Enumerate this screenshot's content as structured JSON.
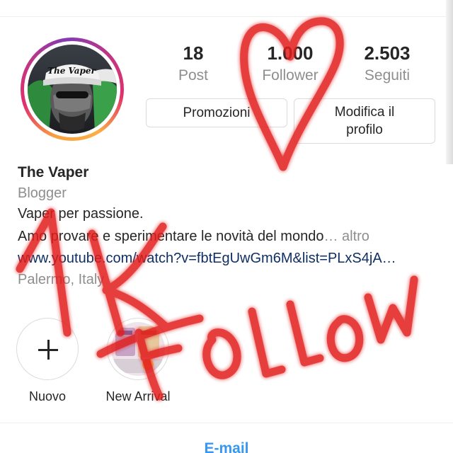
{
  "profile": {
    "avatar_text": "The Vaper",
    "name": "The Vaper",
    "category": "Blogger",
    "bio_line1": "Vaper per passione.",
    "bio_line2": "Amo provare e sperimentare le novità del mondo",
    "bio_ellipsis": "… ",
    "bio_more": "altro",
    "link": "www.youtube.com/watch?v=fbtEgUwGm6M&list=PLxS4jA…",
    "location": "Palermo, Italy"
  },
  "stats": [
    {
      "value": "18",
      "label": "Post"
    },
    {
      "value": "1.000",
      "label": "Follower"
    },
    {
      "value": "2.503",
      "label": "Seguiti"
    }
  ],
  "buttons": {
    "promo": "Promozioni",
    "edit_line1": "Modifica il",
    "edit_line2": "profilo"
  },
  "highlights": [
    {
      "label": "Nuovo",
      "icon": "plus-icon"
    },
    {
      "label": "New Arrival",
      "icon": "highlight-thumbnail"
    }
  ],
  "tabs": {
    "email": "E-mail"
  },
  "annotations": {
    "text": "1K FOLLOW",
    "shape": "heart"
  },
  "colors": {
    "link": "#0f2f63",
    "email": "#3897f0",
    "secondary_text": "#8e8e8e",
    "scribble_red": "#e21c1c"
  }
}
